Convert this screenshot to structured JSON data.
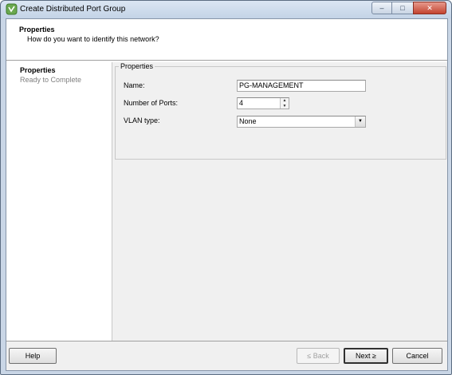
{
  "window": {
    "title": "Create Distributed Port Group",
    "controls": {
      "minimize": "–",
      "maximize": "□",
      "close": "✕"
    }
  },
  "header": {
    "title": "Properties",
    "subtitle": "How do you want to identify this network?"
  },
  "steps": [
    {
      "label": "Properties",
      "state": "active"
    },
    {
      "label": "Ready to Complete",
      "state": "inactive"
    }
  ],
  "properties": {
    "legend": "Properties",
    "name_label": "Name:",
    "name_value": "PG-MANAGEMENT",
    "ports_label": "Number of Ports:",
    "ports_value": "4",
    "vlan_label": "VLAN type:",
    "vlan_value": "None"
  },
  "footer": {
    "help": "Help",
    "back": "≤ Back",
    "next": "Next ≥",
    "cancel": "Cancel"
  },
  "icons": {
    "app": "vsphere-icon"
  }
}
